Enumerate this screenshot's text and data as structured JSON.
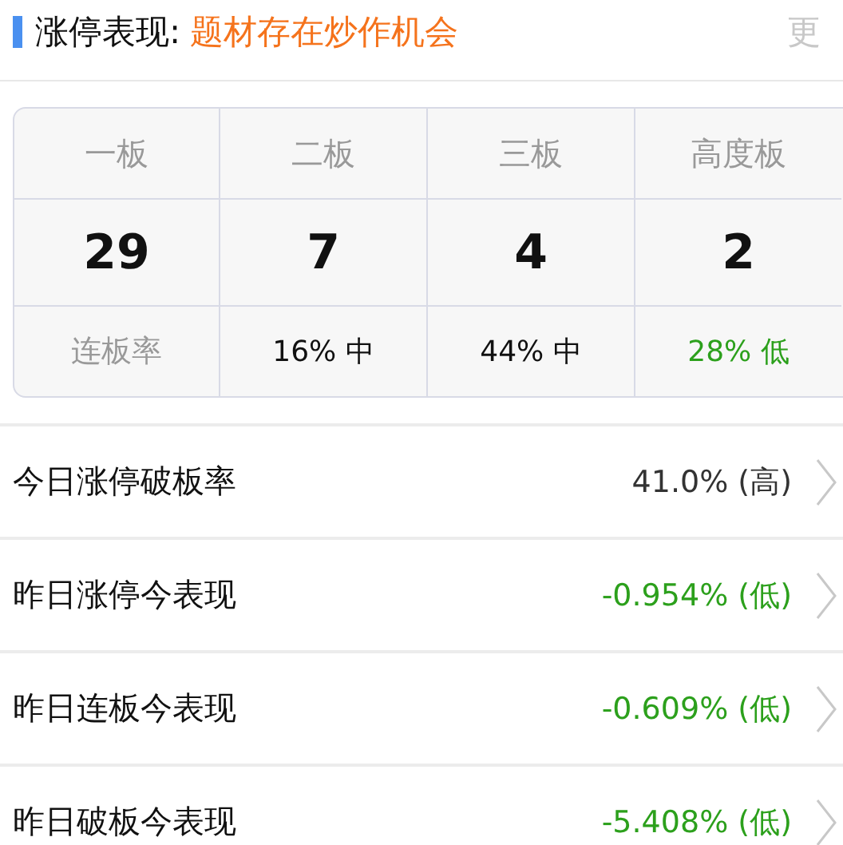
{
  "header": {
    "title": "涨停表现:",
    "theme": "题材存在炒作机会",
    "more": "更"
  },
  "table": {
    "columns": [
      "一板",
      "二板",
      "三板",
      "高度板"
    ],
    "counts": [
      "29",
      "7",
      "4",
      "2"
    ],
    "rate_row": {
      "label": "连板率",
      "cells": [
        {
          "text": "16% 中",
          "color": "#111111"
        },
        {
          "text": "44% 中",
          "color": "#111111"
        },
        {
          "text": "28% 低",
          "color": "#2ca01c"
        }
      ]
    }
  },
  "rows": [
    {
      "label": "今日涨停破板率",
      "value": "41.0% (高)",
      "color": "#333333"
    },
    {
      "label": "昨日涨停今表现",
      "value": "-0.954% (低)",
      "color": "#2ca01c"
    },
    {
      "label": "昨日连板今表现",
      "value": "-0.609% (低)",
      "color": "#2ca01c"
    },
    {
      "label": "昨日破板今表现",
      "value": "-5.408% (低)",
      "color": "#2ca01c"
    }
  ]
}
